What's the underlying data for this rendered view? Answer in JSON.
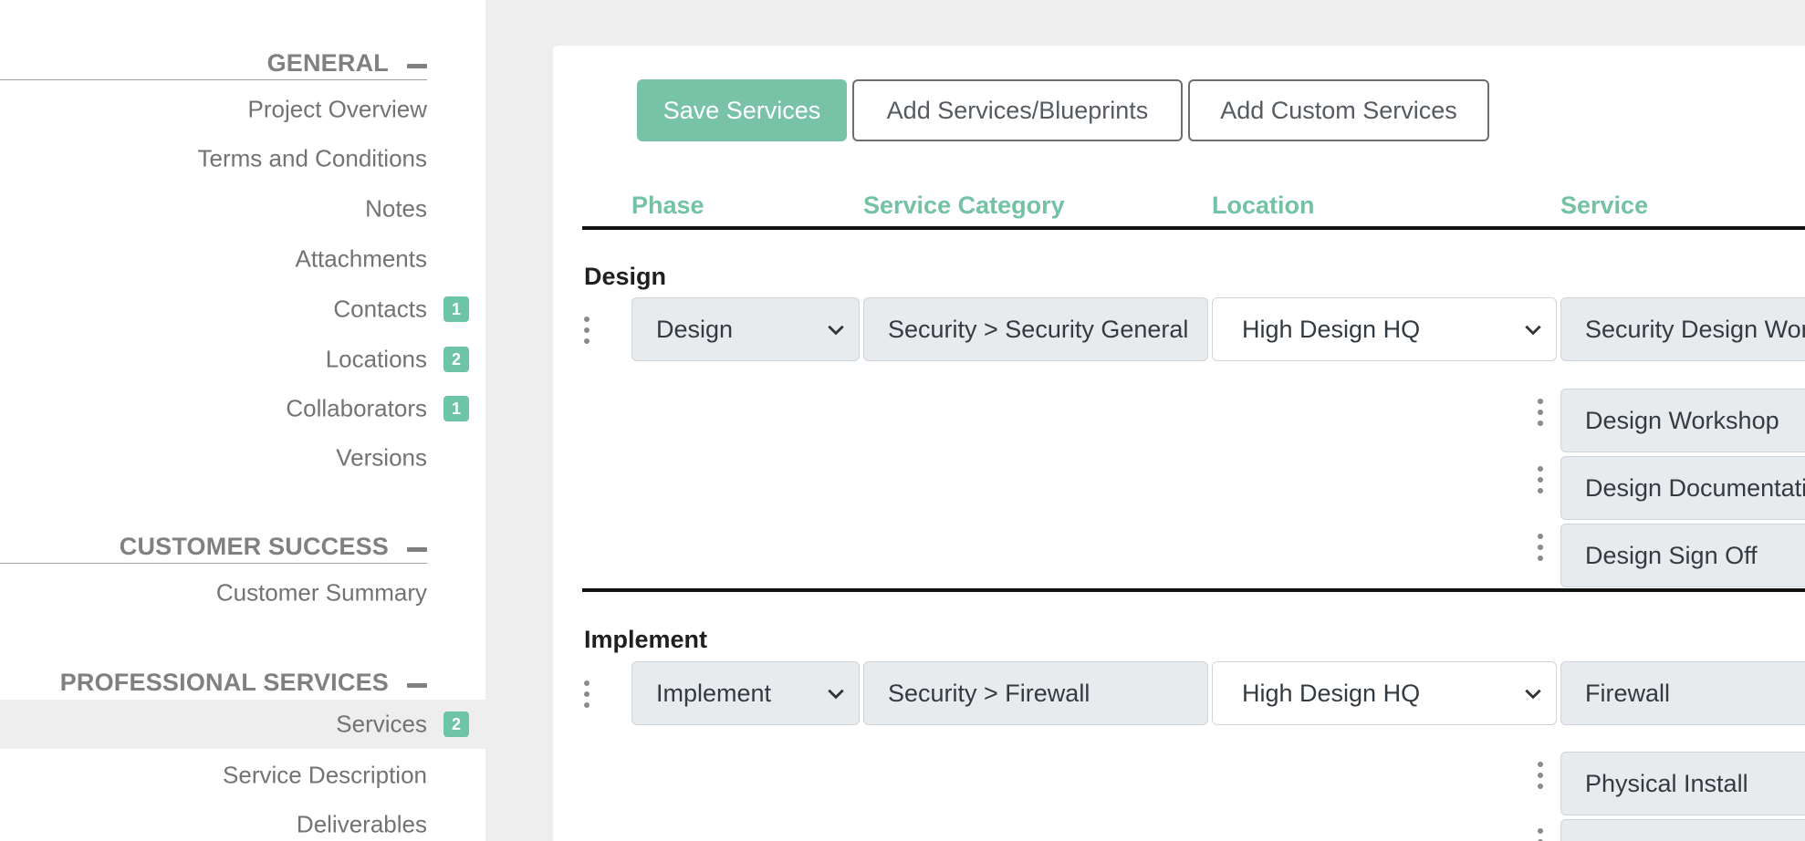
{
  "sidebar": {
    "sections": [
      {
        "title": "GENERAL"
      },
      {
        "title": "CUSTOMER SUCCESS"
      },
      {
        "title": "PROFESSIONAL SERVICES"
      }
    ],
    "items": [
      {
        "label": "Project Overview"
      },
      {
        "label": "Terms and Conditions"
      },
      {
        "label": "Notes"
      },
      {
        "label": "Attachments"
      },
      {
        "label": "Contacts",
        "badge": "1"
      },
      {
        "label": "Locations",
        "badge": "2"
      },
      {
        "label": "Collaborators",
        "badge": "1"
      },
      {
        "label": "Versions"
      },
      {
        "label": "Customer Summary"
      },
      {
        "label": "Services",
        "badge": "2",
        "active": true
      },
      {
        "label": "Service Description"
      },
      {
        "label": "Deliverables"
      }
    ]
  },
  "toolbar": {
    "save_label": "Save Services",
    "add_blueprints_label": "Add Services/Blueprints",
    "add_custom_label": "Add Custom Services"
  },
  "table": {
    "columns": [
      "Phase",
      "Service Category",
      "Location",
      "Service"
    ],
    "groups": [
      {
        "title": "Design",
        "phase": "Design",
        "category": "Security > Security General",
        "location": "High Design HQ",
        "service": "Security Design Workshop",
        "subservices": [
          "Design Workshop",
          "Design Documentation",
          "Design Sign Off"
        ]
      },
      {
        "title": "Implement",
        "phase": "Implement",
        "category": "Security > Firewall",
        "location": "High Design HQ",
        "service": "Firewall",
        "subservices": [
          "Physical Install",
          ""
        ]
      }
    ]
  },
  "colors": {
    "accent": "#78c3a8",
    "badge": "#6ec4a6",
    "header_text": "#72c2a3"
  }
}
